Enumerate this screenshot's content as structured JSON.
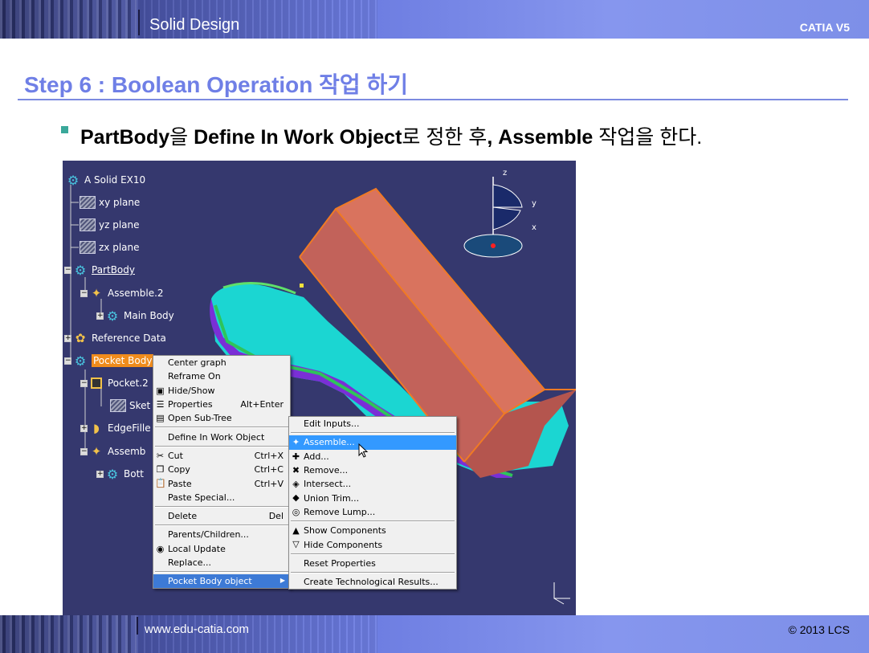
{
  "header": {
    "title": "Solid Design",
    "product": "CATIA V5"
  },
  "step_title": "Step 6 : Boolean Operation 작업 하기",
  "bullet": {
    "b1": "PartBody",
    "t1": "을 ",
    "b2": "Define In Work Object",
    "t2": "로 정한 후",
    "b3": ", Assemble",
    "t3": " 작업을 한다."
  },
  "tree": {
    "root": "A Solid EX10",
    "xy": "xy plane",
    "yz": "yz plane",
    "zx": "zx plane",
    "partbody": "PartBody",
    "assemble2": "Assemble.2",
    "mainbody": "Main Body",
    "refdata": "Reference Data",
    "pocketbody": "Pocket Body",
    "pocket2": "Pocket.2",
    "sketch": "Sket",
    "edgefillet": "EdgeFille",
    "assemble": "Assemb",
    "bottom": "Bott"
  },
  "context_menu": {
    "center_graph": "Center graph",
    "reframe_on": "Reframe On",
    "hide_show": "Hide/Show",
    "properties": "Properties",
    "properties_sc": "Alt+Enter",
    "open_subtree": "Open Sub-Tree",
    "define_work": "Define In Work Object",
    "cut": "Cut",
    "cut_sc": "Ctrl+X",
    "copy": "Copy",
    "copy_sc": "Ctrl+C",
    "paste": "Paste",
    "paste_sc": "Ctrl+V",
    "paste_special": "Paste Special...",
    "delete": "Delete",
    "delete_sc": "Del",
    "parents_children": "Parents/Children...",
    "local_update": "Local Update",
    "replace": "Replace...",
    "pocket_body_object": "Pocket Body object"
  },
  "submenu": {
    "edit_inputs": "Edit Inputs...",
    "assemble": "Assemble...",
    "add": "Add...",
    "remove": "Remove...",
    "intersect": "Intersect...",
    "union_trim": "Union Trim...",
    "remove_lump": "Remove Lump...",
    "show_components": "Show Components",
    "hide_components": "Hide Components",
    "reset_properties": "Reset Properties",
    "create_tech_results": "Create Technological Results..."
  },
  "compass": {
    "z": "z",
    "y": "y",
    "x": "x"
  },
  "footer": {
    "url": "www.edu-catia.com",
    "copyright": "© 2013 LCS"
  },
  "colors": {
    "title": "#6f7fe6",
    "viewport_bg": "#35386e",
    "highlight": "#3399ff",
    "tree_selection": "#f08c1c",
    "box_face": "#c8645a",
    "body_cyan": "#19d9d4"
  }
}
